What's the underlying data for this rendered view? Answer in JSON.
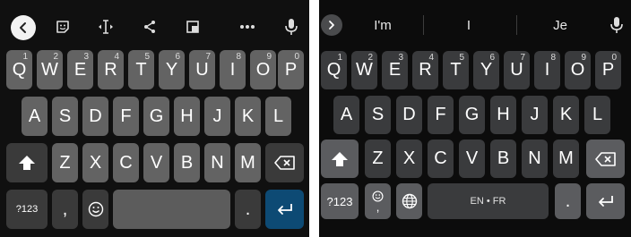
{
  "left_keyboard": {
    "toolbar": {
      "back": "back-icon",
      "sticker": "sticker-icon",
      "cursor": "text-cursor-icon",
      "share": "share-icon",
      "resize": "resize-icon",
      "more": "more-icon",
      "mic": "microphone-icon"
    },
    "row1": [
      {
        "label": "Q",
        "hint": "1"
      },
      {
        "label": "W",
        "hint": "2"
      },
      {
        "label": "E",
        "hint": "3"
      },
      {
        "label": "R",
        "hint": "4"
      },
      {
        "label": "T",
        "hint": "5"
      },
      {
        "label": "Y",
        "hint": "6"
      },
      {
        "label": "U",
        "hint": "7"
      },
      {
        "label": "I",
        "hint": "8"
      },
      {
        "label": "O",
        "hint": "9"
      },
      {
        "label": "P",
        "hint": "0"
      }
    ],
    "row2": [
      "A",
      "S",
      "D",
      "F",
      "G",
      "H",
      "J",
      "K",
      "L"
    ],
    "row3": [
      "Z",
      "X",
      "C",
      "V",
      "B",
      "N",
      "M"
    ],
    "bottom": {
      "symbols": "?123",
      "comma": ",",
      "period": "."
    },
    "colors": {
      "background": "#101010",
      "letter_key": "#636363",
      "enter_key": "#0d4a74"
    }
  },
  "right_keyboard": {
    "suggestions": [
      "I'm",
      "I",
      "Je"
    ],
    "row1": [
      {
        "label": "Q",
        "hint": "1"
      },
      {
        "label": "W",
        "hint": "2"
      },
      {
        "label": "E",
        "hint": "3"
      },
      {
        "label": "R",
        "hint": "4"
      },
      {
        "label": "T",
        "hint": "5"
      },
      {
        "label": "Y",
        "hint": "6"
      },
      {
        "label": "U",
        "hint": "7"
      },
      {
        "label": "I",
        "hint": "8"
      },
      {
        "label": "O",
        "hint": "9"
      },
      {
        "label": "P",
        "hint": "0"
      }
    ],
    "row2": [
      "A",
      "S",
      "D",
      "F",
      "G",
      "H",
      "J",
      "K",
      "L"
    ],
    "row3": [
      "Z",
      "X",
      "C",
      "V",
      "B",
      "N",
      "M"
    ],
    "bottom": {
      "symbols": "?123",
      "comma": ",",
      "space": "EN • FR",
      "period": "."
    },
    "colors": {
      "background": "#0c0c0c",
      "letter_key": "#3a3b3d",
      "function_key": "#5b5c5f"
    }
  }
}
